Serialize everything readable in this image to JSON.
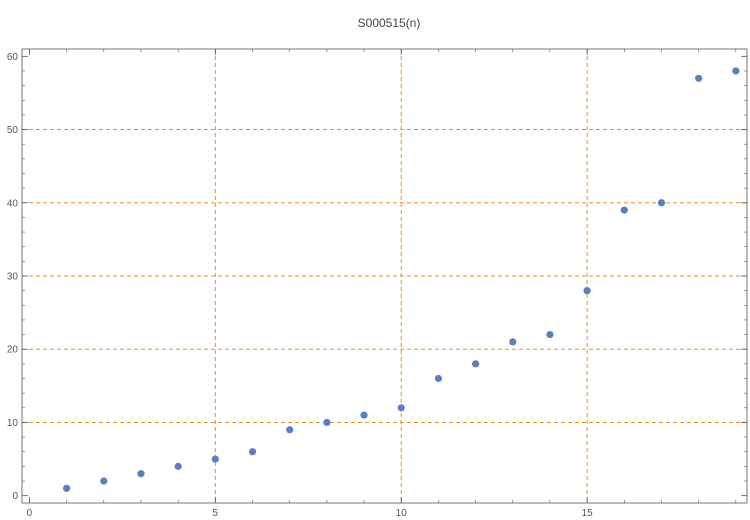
{
  "chart_data": {
    "type": "scatter",
    "title": "S000515(n)",
    "xlabel": "",
    "ylabel": "",
    "x": [
      1,
      2,
      3,
      4,
      5,
      6,
      7,
      8,
      9,
      10,
      11,
      12,
      13,
      14,
      15,
      16,
      17,
      18,
      19
    ],
    "y": [
      1,
      2,
      3,
      4,
      5,
      6,
      9,
      10,
      11,
      12,
      16,
      18,
      21,
      22,
      28,
      39,
      40,
      57,
      58
    ],
    "xlim": [
      -0.2,
      19.3
    ],
    "ylim": [
      -1,
      61
    ],
    "xticks": [
      0,
      5,
      10,
      15
    ],
    "yticks": [
      0,
      10,
      20,
      30,
      40,
      50,
      60
    ],
    "grid_x": [
      5,
      10,
      15
    ],
    "grid_y": [
      10,
      20,
      30,
      40,
      50
    ],
    "colors": {
      "points": "#5b7fbf",
      "grid": "#e5922a",
      "axis": "#555555"
    }
  }
}
